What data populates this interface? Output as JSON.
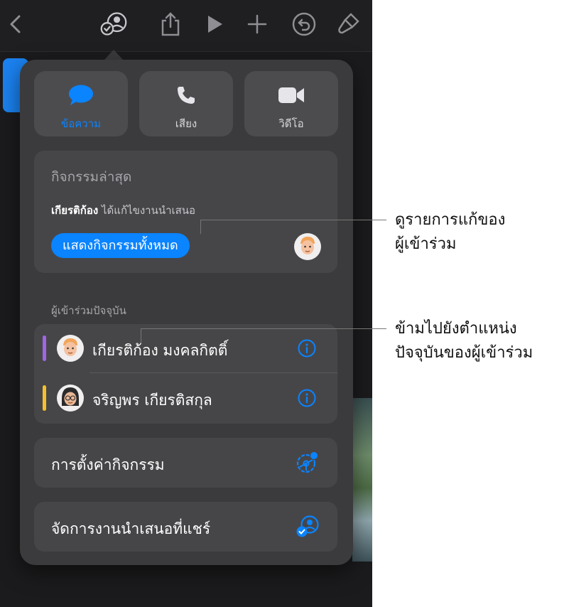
{
  "toolbar": {
    "icons": [
      "back-chevron-icon",
      "collaboration-icon",
      "share-icon",
      "play-icon",
      "add-icon",
      "undo-icon",
      "format-brush-icon"
    ]
  },
  "contact": {
    "message_label": "ข้อความ",
    "audio_label": "เสียง",
    "video_label": "วิดีโอ"
  },
  "recent": {
    "title": "กิจกรรมล่าสุด",
    "actor": "เกียรติก้อง",
    "action": " ได้แก้ไขงานนำเสนอ",
    "show_all_label": "แสดงกิจกรรมทั้งหมด"
  },
  "participants": {
    "header": "ผู้เข้าร่วมปัจจุบัน",
    "items": [
      {
        "name": "เกียรติก้อง มงคลกิตติ์",
        "color": "#a066e6"
      },
      {
        "name": "จริญพร เกียรติสกุล",
        "color": "#f5c02b"
      }
    ]
  },
  "activity_settings_label": "การตั้งค่ากิจกรรม",
  "manage_shared_label": "จัดการงานนำเสนอที่แชร์",
  "callouts": {
    "c1_line1": "ดูรายการแก้ของ",
    "c1_line2": "ผู้เข้าร่วม",
    "c2_line1": "ข้ามไปยังตำแหน่ง",
    "c2_line2": "ปัจจุบันของผู้เข้าร่วม"
  },
  "colors": {
    "accent": "#0a84ff",
    "popover": "#3b3b3d",
    "card": "#464649"
  }
}
